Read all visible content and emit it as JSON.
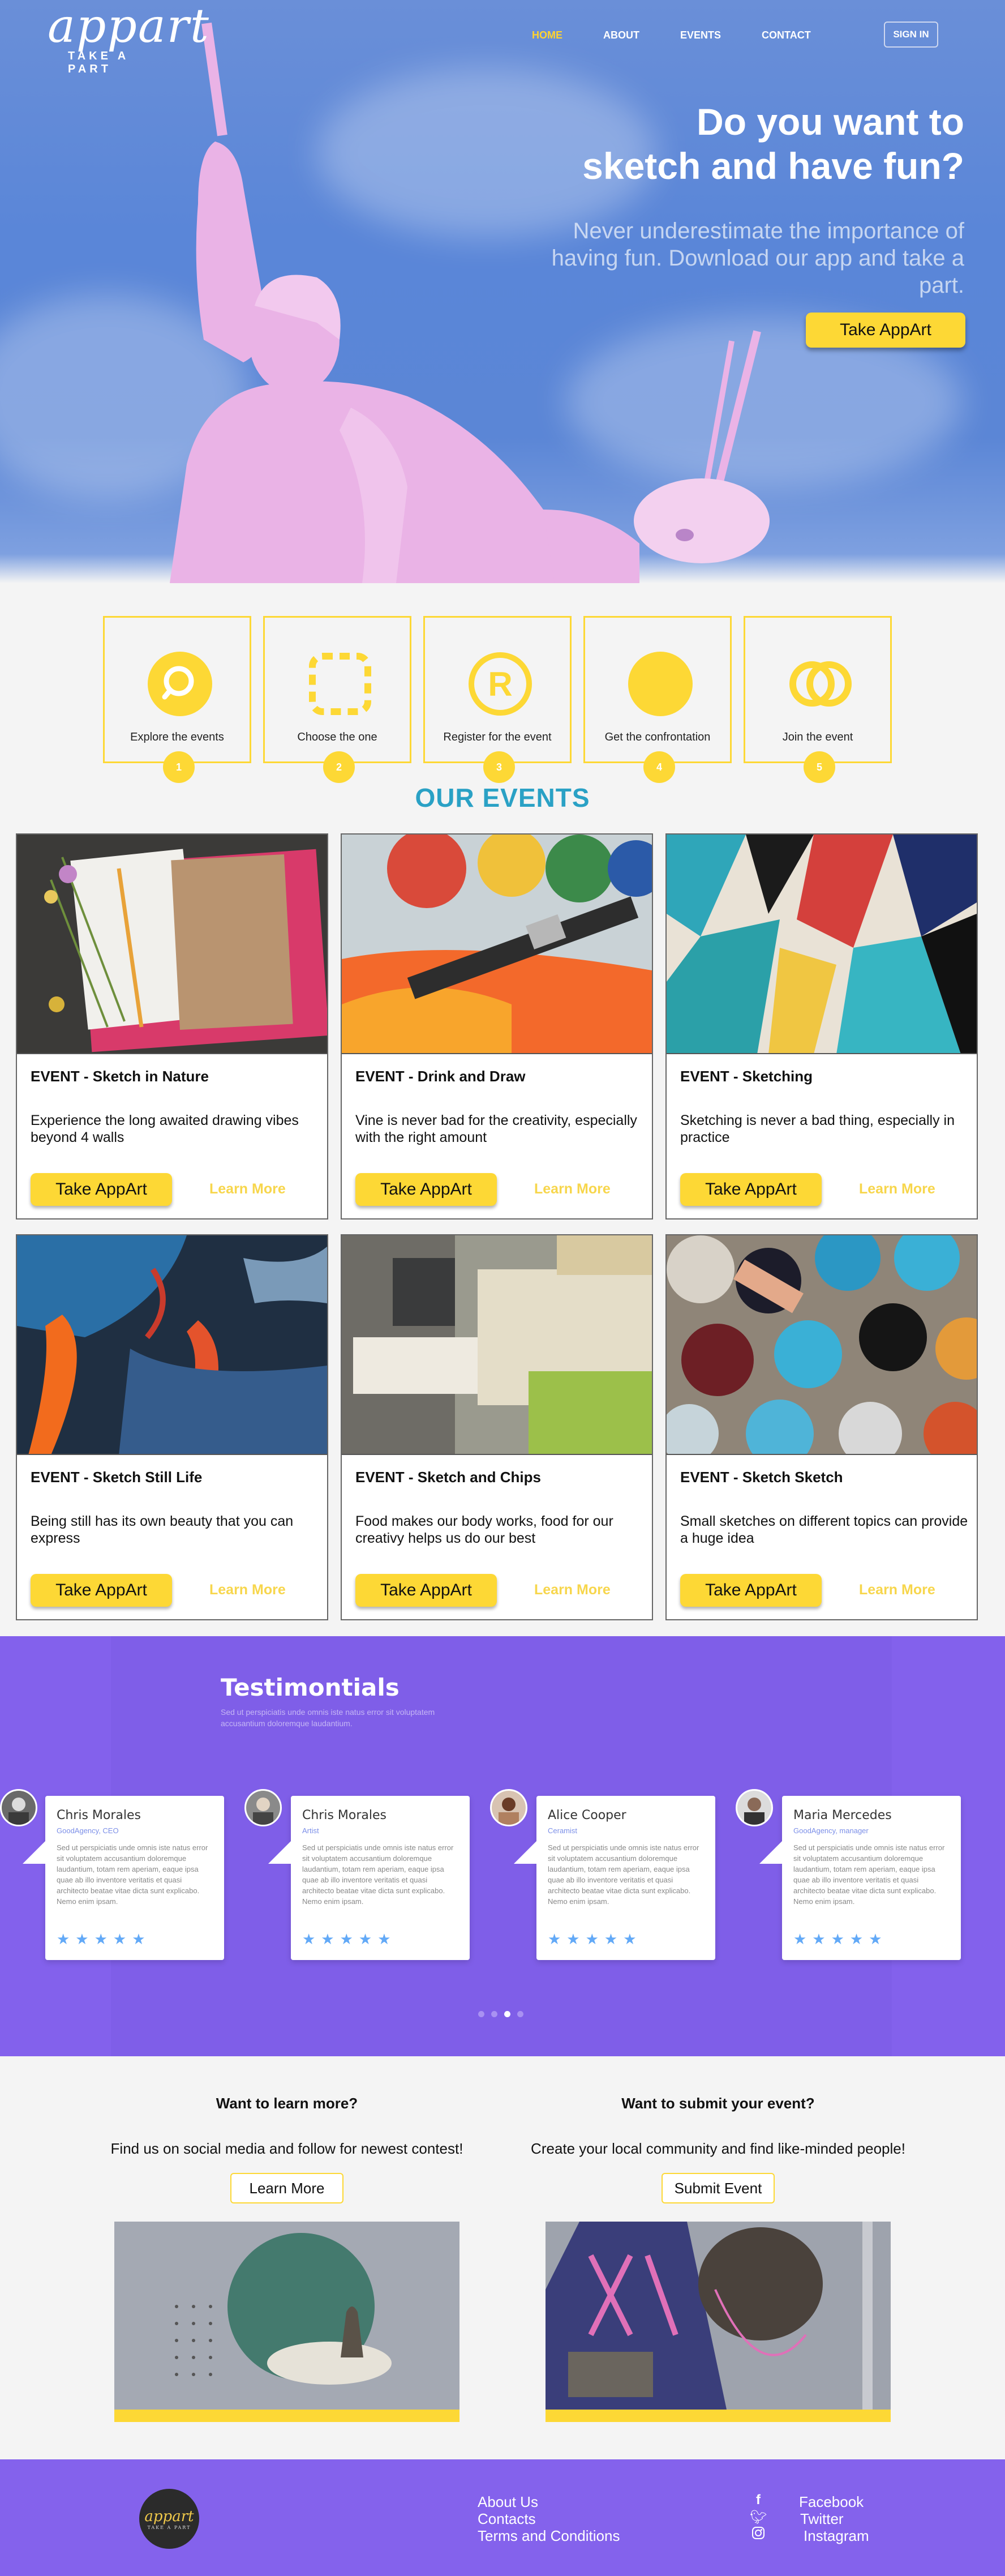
{
  "brand": {
    "logo_word": "appart",
    "logo_tagline": "TAKE A PART"
  },
  "nav": {
    "items": [
      "HOME",
      "ABOUT",
      "EVENTS",
      "CONTACT"
    ],
    "active": "HOME",
    "signin": "SIGN IN"
  },
  "hero": {
    "title_line1": "Do you want to",
    "title_line2": "sketch and have fun?",
    "text": "Never underestimate the importance of having fun. Download our app and take a part.",
    "button": "Take AppArt"
  },
  "steps": [
    {
      "label": "Explore the events",
      "num": "1",
      "icon": "search-icon"
    },
    {
      "label": "Choose the one",
      "num": "2",
      "icon": "dashed-square-icon"
    },
    {
      "label": "Register for the event",
      "num": "3",
      "icon": "registered-icon"
    },
    {
      "label": "Get the confrontation",
      "num": "4",
      "icon": "filled-circle-icon"
    },
    {
      "label": "Join the event",
      "num": "5",
      "icon": "rings-icon"
    }
  ],
  "events_title": "OUR EVENTS",
  "events": [
    {
      "title": "EVENT - Sketch in Nature",
      "desc": "Experience the long awaited drawing vibes beyond 4 walls",
      "button": "Take AppArt",
      "more": "Learn More"
    },
    {
      "title": "EVENT - Drink and Draw",
      "desc": "Vine is never bad for the creativity, especially with the right amount",
      "button": "Take AppArt",
      "more": "Learn More"
    },
    {
      "title": "EVENT - Sketching",
      "desc": "Sketching is never a bad thing, especially in practice",
      "button": "Take AppArt",
      "more": "Learn More"
    },
    {
      "title": "EVENT - Sketch Still Life",
      "desc": "Being still has its own beauty that you can express",
      "button": "Take AppArt",
      "more": "Learn More"
    },
    {
      "title": "EVENT - Sketch and Chips",
      "desc": "Food makes our body works, food for our creativy helps us do our best",
      "button": "Take AppArt",
      "more": "Learn More"
    },
    {
      "title": "EVENT - Sketch Sketch",
      "desc": "Small sketches on different topics can provide a huge idea",
      "button": "Take AppArt",
      "more": "Learn More"
    }
  ],
  "testimonials": {
    "title": "Testimontials",
    "subtitle": "Sed ut perspiciatis unde omnis iste natus error sit voluptatem accusantium doloremque laudantium.",
    "items": [
      {
        "name": "Chris Morales",
        "role": "GoodAgency, CEO",
        "text": "Sed ut perspiciatis unde omnis iste natus error sit voluptatem accusantium doloremque laudantium, totam rem aperiam, eaque ipsa quae ab illo inventore veritatis et quasi architecto beatae vitae dicta sunt explicabo. Nemo enim ipsam.",
        "stars": "★★★★★"
      },
      {
        "name": "Chris Morales",
        "role": "Artist",
        "text": "Sed ut perspiciatis unde omnis iste natus error sit voluptatem accusantium doloremque laudantium, totam rem aperiam, eaque ipsa quae ab illo inventore veritatis et quasi architecto beatae vitae dicta sunt explicabo. Nemo enim ipsam.",
        "stars": "★★★★★"
      },
      {
        "name": "Alice Cooper",
        "role": "Ceramist",
        "text": "Sed ut perspiciatis unde omnis iste natus error sit voluptatem accusantium doloremque laudantium, totam rem aperiam, eaque ipsa quae ab illo inventore veritatis et quasi architecto beatae vitae dicta sunt explicabo. Nemo enim ipsam.",
        "stars": "★★★★★"
      },
      {
        "name": "Maria Mercedes",
        "role": "GoodAgency, manager",
        "text": "Sed ut perspiciatis unde omnis iste natus error sit voluptatem accusantium doloremque laudantium, totam rem aperiam, eaque ipsa quae ab illo inventore veritatis et quasi architecto beatae vitae dicta sunt explicabo. Nemo enim ipsam.",
        "stars": "★★★★★"
      }
    ],
    "active_dot": 3
  },
  "learn": {
    "title": "Want to learn more?",
    "text": "Find us on social media and follow for newest contest!",
    "button": "Learn More"
  },
  "submit": {
    "title": "Want to submit your event?",
    "text": "Create your local community and find like-minded people!",
    "button": "Submit Event"
  },
  "footer": {
    "links": [
      "About Us",
      "Contacts",
      "Terms and Conditions"
    ],
    "social": [
      {
        "label": "Facebook",
        "icon": "facebook-icon"
      },
      {
        "label": "Twitter",
        "icon": "twitter-icon"
      },
      {
        "label": "Instagram",
        "icon": "instagram-icon"
      }
    ],
    "logo_word": "appart",
    "logo_tagline": "TAKE A PART"
  },
  "colors": {
    "accent": "#fdd835",
    "hero_blue": "#5b86d6",
    "statue_pink": "#eab3e6",
    "purple": "#8361ec",
    "teal_title": "#2aa1c5"
  }
}
